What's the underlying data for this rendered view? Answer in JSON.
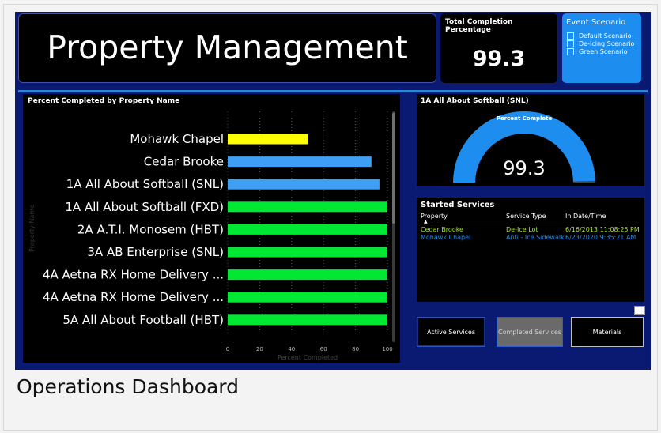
{
  "header": {
    "title": "Property Management"
  },
  "kpi": {
    "label": "Total Completion Percentage",
    "value": "99.3"
  },
  "event_scenario": {
    "label": "Event Scenario",
    "options": [
      "Default Scenario",
      "De-Icing Scenario",
      "Green Scenario"
    ]
  },
  "gauge": {
    "title": "1A All About Softball (SNL)",
    "label": "Percent Complete",
    "value": "99.3",
    "fraction": 0.993,
    "color": "#1e8df0"
  },
  "services": {
    "title": "Started Services",
    "columns": [
      "Property",
      "Service Type",
      "In Date/Time"
    ],
    "rows": [
      {
        "property": "Cedar Brooke",
        "service": "De-Ice Lot",
        "datetime": "6/16/2013 11:08:25 PM",
        "color": "#a8e23a"
      },
      {
        "property": "Mohawk Chapel",
        "service": "Anti - Ice Sidewalk",
        "datetime": "6/23/2020 9:35:21 AM",
        "color": "#1e8df0"
      }
    ]
  },
  "buttons": {
    "active": "Active Services",
    "completed": "Completed Services",
    "materials": "Materials",
    "more": "..."
  },
  "chart_data": {
    "type": "bar",
    "orientation": "horizontal",
    "title": "Percent Completed by Property Name",
    "xlabel": "Percent Completed",
    "ylabel": "Property Name",
    "xlim": [
      0,
      100
    ],
    "xticks": [
      0,
      20,
      40,
      60,
      80,
      100
    ],
    "grid": true,
    "categories": [
      "Mohawk Chapel",
      "Cedar Brooke",
      "1A All About Softball (SNL)",
      "1A All About Softball (FXD)",
      "2A A.T.I. Monosem (HBT)",
      "3A AB Enterprise (SNL)",
      "4A Aetna RX Home Delivery ...",
      "4A Aetna RX Home Delivery ...",
      "5A All About Football (HBT)"
    ],
    "values": [
      50,
      90,
      95,
      100,
      100,
      100,
      100,
      100,
      100
    ],
    "colors": [
      "#ffff00",
      "#3da0f5",
      "#3da0f5",
      "#00e832",
      "#00e832",
      "#00e832",
      "#00e832",
      "#00e832",
      "#00e832"
    ]
  },
  "caption": "Operations Dashboard"
}
